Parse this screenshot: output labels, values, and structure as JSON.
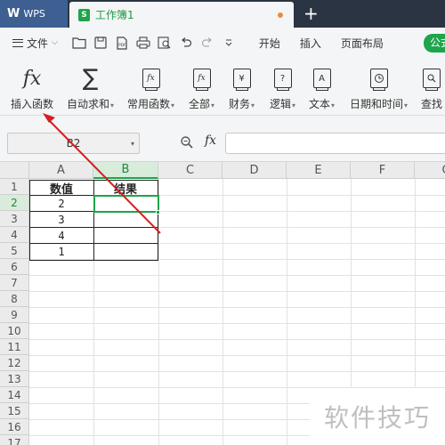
{
  "tabs": {
    "app_logo": "W",
    "app_name": "WPS",
    "doc_icon": "S",
    "doc_name": "工作簿1",
    "add": "+"
  },
  "menu": {
    "file_label": "文件",
    "items": [
      "开始",
      "插入",
      "页面布局"
    ],
    "active_partial": "公式"
  },
  "ribbon": {
    "buttons": [
      {
        "label": "插入函数",
        "icon": "fx-icon",
        "dropdown": false
      },
      {
        "label": "自动求和",
        "icon": "sigma-icon",
        "dropdown": true
      },
      {
        "label": "常用函数",
        "icon": "star-fx-icon",
        "dropdown": true
      },
      {
        "label": "全部",
        "icon": "fx-box-icon",
        "dropdown": true
      },
      {
        "label": "财务",
        "icon": "yen-book-icon",
        "dropdown": true
      },
      {
        "label": "逻辑",
        "icon": "question-book-icon",
        "dropdown": true
      },
      {
        "label": "文本",
        "icon": "a-book-icon",
        "dropdown": true
      },
      {
        "label": "日期和时间",
        "icon": "clock-book-icon",
        "dropdown": true
      },
      {
        "label": "查找",
        "icon": "search-book-icon",
        "dropdown": false
      }
    ],
    "icon_texts": {
      "fx": "fx",
      "sigma": "∑",
      "yen": "¥",
      "question": "?",
      "a": "A"
    }
  },
  "formula_bar": {
    "name_box": "B2",
    "fx_label": "fx",
    "formula": ""
  },
  "grid": {
    "columns": [
      "A",
      "B",
      "C",
      "D",
      "E",
      "F",
      "G"
    ],
    "selected_column": "B",
    "rows": [
      "1",
      "2",
      "3",
      "4",
      "5",
      "6",
      "7",
      "8",
      "9",
      "10",
      "11",
      "12",
      "13",
      "14",
      "15",
      "16",
      "17"
    ],
    "selected_row": "2",
    "cells": {
      "A1": "数值",
      "B1": "结果",
      "A2": "2",
      "A3": "3",
      "A4": "4",
      "A5": "1"
    }
  },
  "watermark": "软件技巧",
  "colors": {
    "accent_green": "#1ea44a",
    "annotation_arrow": "#d22020",
    "tabbar": "#2b3442"
  }
}
